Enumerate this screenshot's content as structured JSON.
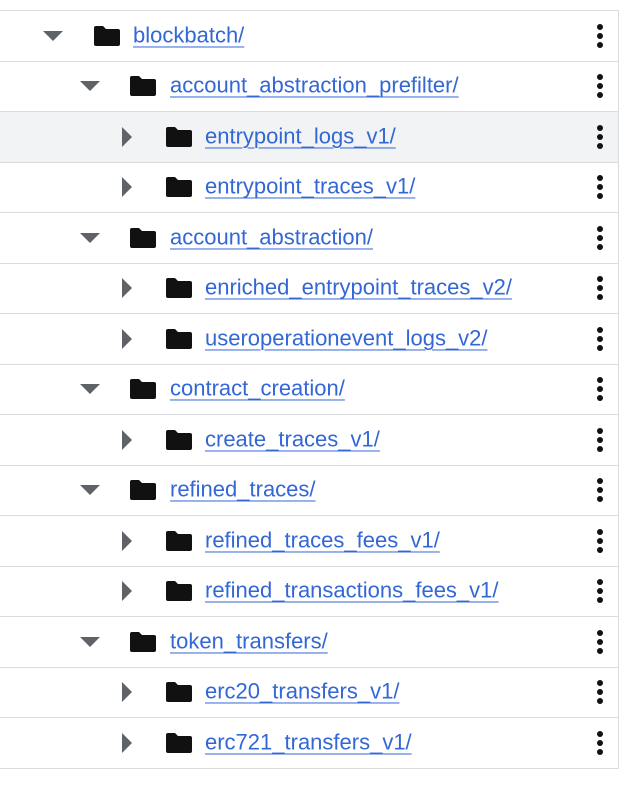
{
  "rows": [
    {
      "label": "blockbatch/",
      "level": 0,
      "expanded": true,
      "highlighted": false
    },
    {
      "label": "account_abstraction_prefilter/",
      "level": 1,
      "expanded": true,
      "highlighted": false
    },
    {
      "label": "entrypoint_logs_v1/",
      "level": 2,
      "expanded": false,
      "highlighted": true
    },
    {
      "label": "entrypoint_traces_v1/",
      "level": 2,
      "expanded": false,
      "highlighted": false
    },
    {
      "label": "account_abstraction/",
      "level": 1,
      "expanded": true,
      "highlighted": false
    },
    {
      "label": "enriched_entrypoint_traces_v2/",
      "level": 2,
      "expanded": false,
      "highlighted": false
    },
    {
      "label": "useroperationevent_logs_v2/",
      "level": 2,
      "expanded": false,
      "highlighted": false
    },
    {
      "label": "contract_creation/",
      "level": 1,
      "expanded": true,
      "highlighted": false
    },
    {
      "label": "create_traces_v1/",
      "level": 2,
      "expanded": false,
      "highlighted": false
    },
    {
      "label": "refined_traces/",
      "level": 1,
      "expanded": true,
      "highlighted": false
    },
    {
      "label": "refined_traces_fees_v1/",
      "level": 2,
      "expanded": false,
      "highlighted": false
    },
    {
      "label": "refined_transactions_fees_v1/",
      "level": 2,
      "expanded": false,
      "highlighted": false
    },
    {
      "label": "token_transfers/",
      "level": 1,
      "expanded": true,
      "highlighted": false
    },
    {
      "label": "erc20_transfers_v1/",
      "level": 2,
      "expanded": false,
      "highlighted": false
    },
    {
      "label": "erc721_transfers_v1/",
      "level": 2,
      "expanded": false,
      "highlighted": false
    }
  ],
  "icons": {
    "expanded": "triangle-down-icon",
    "collapsed": "triangle-right-icon",
    "folder": "folder-icon",
    "menu": "more-vertical-icon"
  },
  "colors": {
    "link": "#3367d6",
    "highlight": "#f1f3f4",
    "icon": "#111111",
    "toggle": "#5f6368"
  }
}
